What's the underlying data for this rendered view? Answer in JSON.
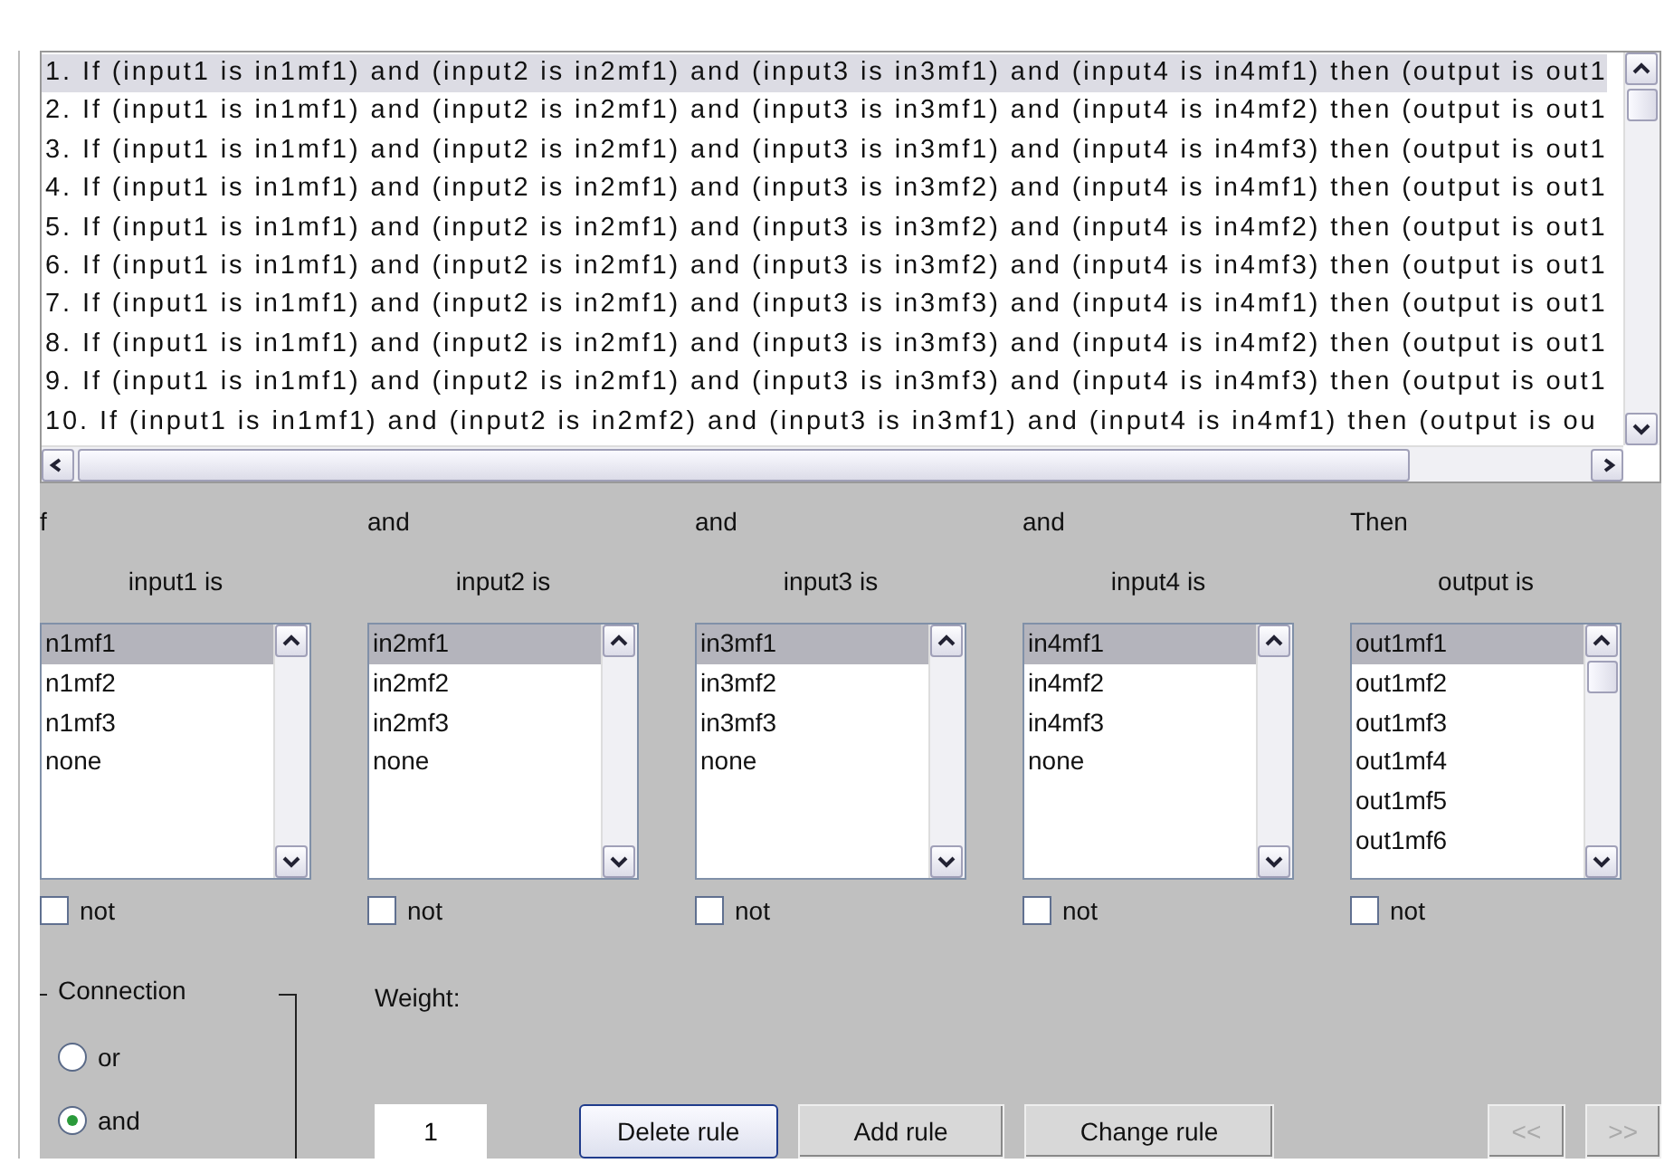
{
  "rules": {
    "items": [
      {
        "text": "1. If (input1 is in1mf1) and (input2 is in2mf1) and (input3 is in3mf1) and (input4 is in4mf1) then (output is out1",
        "selected": true
      },
      {
        "text": "2. If (input1 is in1mf1) and (input2 is in2mf1) and (input3 is in3mf1) and (input4 is in4mf2) then (output is out1",
        "selected": false
      },
      {
        "text": "3. If (input1 is in1mf1) and (input2 is in2mf1) and (input3 is in3mf1) and (input4 is in4mf3) then (output is out1",
        "selected": false
      },
      {
        "text": "4. If (input1 is in1mf1) and (input2 is in2mf1) and (input3 is in3mf2) and (input4 is in4mf1) then (output is out1",
        "selected": false
      },
      {
        "text": "5. If (input1 is in1mf1) and (input2 is in2mf1) and (input3 is in3mf2) and (input4 is in4mf2) then (output is out1",
        "selected": false
      },
      {
        "text": "6. If (input1 is in1mf1) and (input2 is in2mf1) and (input3 is in3mf2) and (input4 is in4mf3) then (output is out1",
        "selected": false
      },
      {
        "text": "7. If (input1 is in1mf1) and (input2 is in2mf1) and (input3 is in3mf3) and (input4 is in4mf1) then (output is out1",
        "selected": false
      },
      {
        "text": "8. If (input1 is in1mf1) and (input2 is in2mf1) and (input3 is in3mf3) and (input4 is in4mf2) then (output is out1",
        "selected": false
      },
      {
        "text": "9. If (input1 is in1mf1) and (input2 is in2mf1) and (input3 is in3mf3) and (input4 is in4mf3) then (output is out1",
        "selected": false
      },
      {
        "text": "10. If (input1 is in1mf1) and (input2 is in2mf2) and (input3 is in3mf1) and (input4 is in4mf1) then (output is ou",
        "selected": false
      }
    ]
  },
  "columns": [
    {
      "connector": "f",
      "label": "input1 is",
      "options": [
        {
          "text": "n1mf1",
          "selected": true
        },
        {
          "text": "n1mf2",
          "selected": false
        },
        {
          "text": "n1mf3",
          "selected": false
        },
        {
          "text": "none",
          "selected": false
        }
      ],
      "not": {
        "label": "not",
        "checked": false
      }
    },
    {
      "connector": "and",
      "label": "input2 is",
      "options": [
        {
          "text": "in2mf1",
          "selected": true
        },
        {
          "text": "in2mf2",
          "selected": false
        },
        {
          "text": "in2mf3",
          "selected": false
        },
        {
          "text": "none",
          "selected": false
        }
      ],
      "not": {
        "label": "not",
        "checked": false
      }
    },
    {
      "connector": "and",
      "label": "input3 is",
      "options": [
        {
          "text": "in3mf1",
          "selected": true
        },
        {
          "text": "in3mf2",
          "selected": false
        },
        {
          "text": "in3mf3",
          "selected": false
        },
        {
          "text": "none",
          "selected": false
        }
      ],
      "not": {
        "label": "not",
        "checked": false
      }
    },
    {
      "connector": "and",
      "label": "input4 is",
      "options": [
        {
          "text": "in4mf1",
          "selected": true
        },
        {
          "text": "in4mf2",
          "selected": false
        },
        {
          "text": "in4mf3",
          "selected": false
        },
        {
          "text": "none",
          "selected": false
        }
      ],
      "not": {
        "label": "not",
        "checked": false
      }
    },
    {
      "connector": "Then",
      "label": "output is",
      "options": [
        {
          "text": "out1mf1",
          "selected": true
        },
        {
          "text": "out1mf2",
          "selected": false
        },
        {
          "text": "out1mf3",
          "selected": false
        },
        {
          "text": "out1mf4",
          "selected": false
        },
        {
          "text": "out1mf5",
          "selected": false
        },
        {
          "text": "out1mf6",
          "selected": false
        }
      ],
      "not": {
        "label": "not",
        "checked": false
      }
    }
  ],
  "connection": {
    "title": "Connection",
    "options": [
      {
        "label": "or",
        "selected": false
      },
      {
        "label": "and",
        "selected": true
      }
    ]
  },
  "weight": {
    "label": "Weight:",
    "value": "1"
  },
  "buttons": [
    {
      "label": "Delete rule",
      "disabled": false,
      "focused": true
    },
    {
      "label": "Add rule",
      "disabled": false,
      "focused": false
    },
    {
      "label": "Change rule",
      "disabled": false,
      "focused": false
    }
  ],
  "nav_buttons": [
    {
      "label": "<<",
      "disabled": true
    },
    {
      "label": ">>",
      "disabled": true
    }
  ]
}
